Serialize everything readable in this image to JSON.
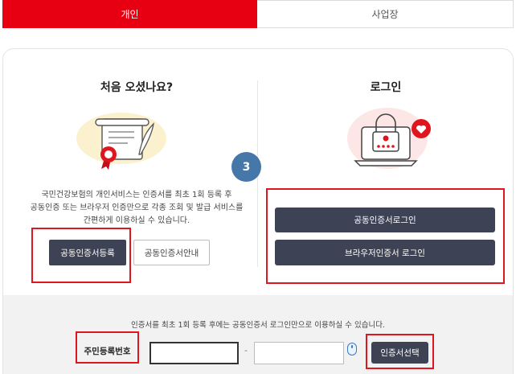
{
  "tabs": [
    {
      "label": "개인",
      "active": true
    },
    {
      "label": "사업장",
      "active": false
    }
  ],
  "left": {
    "heading": "처음 오셨나요?",
    "info_line1": "국민건강보험의 개인서비스는 인증서를 최초 1회 등록 후",
    "info_line2": "공동인증 또는 브라우저 인증만으로 각종 조회 및 발급 서비스를",
    "info_line3": "간편하게 이용하실 수 있습니다.",
    "register_button": "공동인증서등록",
    "guide_button": "공동인증서안내",
    "icon": "certificate-scroll-icon"
  },
  "right": {
    "heading": "로그인",
    "cert_login_button": "공동인증서로그인",
    "browser_login_button": "브라우저인증서 로그인",
    "icon": "laptop-lock-icon"
  },
  "step_badge": "3",
  "bottom": {
    "note": "인증서를 최초 1회 등록 후에는 공동인증서 로그인만으로 이용하실 수 있습니다.",
    "rrn_label": "주민등록번호",
    "rrn_first": "",
    "rrn_second": "",
    "select_cert_button": "인증서선택"
  },
  "colors": {
    "brand_red": "#e60012",
    "button_dark": "#3d4354",
    "highlight_red": "#e0161f",
    "step_blue": "#4577a8"
  }
}
